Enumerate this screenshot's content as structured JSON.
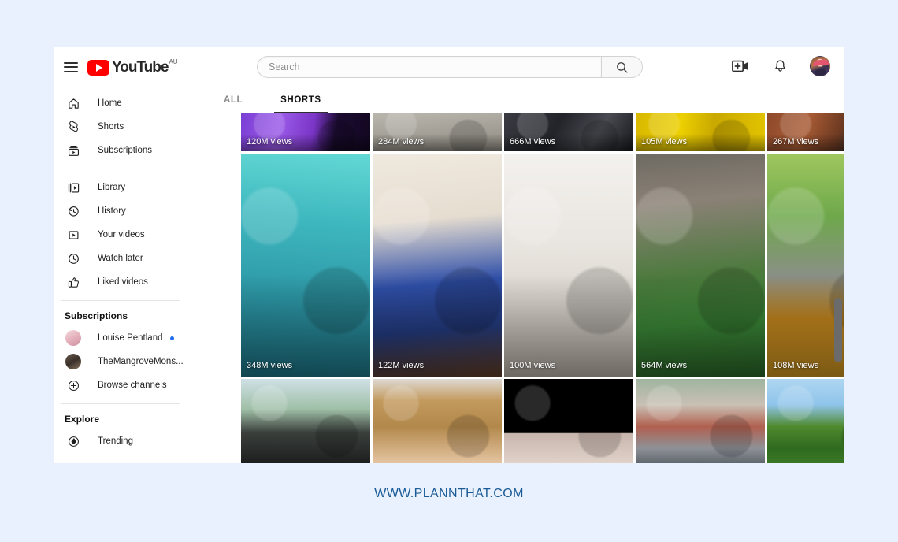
{
  "watermark": "WWW.PLANNTHAT.COM",
  "brand": {
    "name": "YouTube",
    "region_sup": "AU",
    "red": "#ff0000"
  },
  "search": {
    "placeholder": "Search",
    "value": "",
    "button_icon": "search-icon"
  },
  "topbar": {
    "menu_icon": "hamburger-menu-icon",
    "create_icon": "create-video-icon",
    "notifications_icon": "bell-icon",
    "avatar_icon": "account-avatar"
  },
  "sidebar": {
    "primary": [
      {
        "label": "Home",
        "icon": "home-icon"
      },
      {
        "label": "Shorts",
        "icon": "shorts-icon"
      },
      {
        "label": "Subscriptions",
        "icon": "subscriptions-icon"
      }
    ],
    "library": [
      {
        "label": "Library",
        "icon": "library-icon"
      },
      {
        "label": "History",
        "icon": "history-icon"
      },
      {
        "label": "Your videos",
        "icon": "your-videos-icon"
      },
      {
        "label": "Watch later",
        "icon": "clock-icon"
      },
      {
        "label": "Liked videos",
        "icon": "thumbs-up-icon"
      }
    ],
    "subscriptions_heading": "Subscriptions",
    "channels": [
      {
        "label": "Louise Pentland",
        "icon": "channel-avatar",
        "has_new": true
      },
      {
        "label": "TheMangroveMons...",
        "icon": "channel-avatar",
        "has_new": false
      },
      {
        "label": "Browse channels",
        "icon": "plus-circle-icon",
        "has_new": false
      }
    ],
    "explore_heading": "Explore",
    "explore": [
      {
        "label": "Trending",
        "icon": "trending-icon"
      }
    ]
  },
  "main": {
    "tabs": [
      {
        "label": "ALL",
        "active": false
      },
      {
        "label": "SHORTS",
        "active": true
      }
    ],
    "grid": {
      "row_top": [
        {
          "views": "120M views",
          "art": "t-purple"
        },
        {
          "views": "284M views",
          "art": "t-pavement"
        },
        {
          "views": "666M views",
          "art": "t-darkcoat"
        },
        {
          "views": "105M views",
          "art": "t-yellow"
        },
        {
          "views": "267M views",
          "art": "t-brick"
        }
      ],
      "row_middle": [
        {
          "views": "348M views",
          "art": "t-mermaid"
        },
        {
          "views": "122M views",
          "art": "t-cake"
        },
        {
          "views": "100M views",
          "art": "t-room"
        },
        {
          "views": "564M views",
          "art": "t-train"
        },
        {
          "views": "108M views",
          "art": "t-street"
        }
      ],
      "row_bottom": [
        {
          "views": "",
          "art": "t-car"
        },
        {
          "views": "",
          "art": "t-face"
        },
        {
          "views": "",
          "art": "t-black"
        },
        {
          "views": "",
          "art": "t-building"
        },
        {
          "views": "",
          "art": "t-bush"
        }
      ]
    }
  },
  "scrollbar": {
    "name": "page-scrollbar"
  },
  "colors": {
    "page_background": "#e8f1fd",
    "panel": "#ffffff",
    "accent_red": "#ff0000",
    "watermark_blue": "#1a5a96",
    "tab_underline": "#2f2f2f"
  }
}
